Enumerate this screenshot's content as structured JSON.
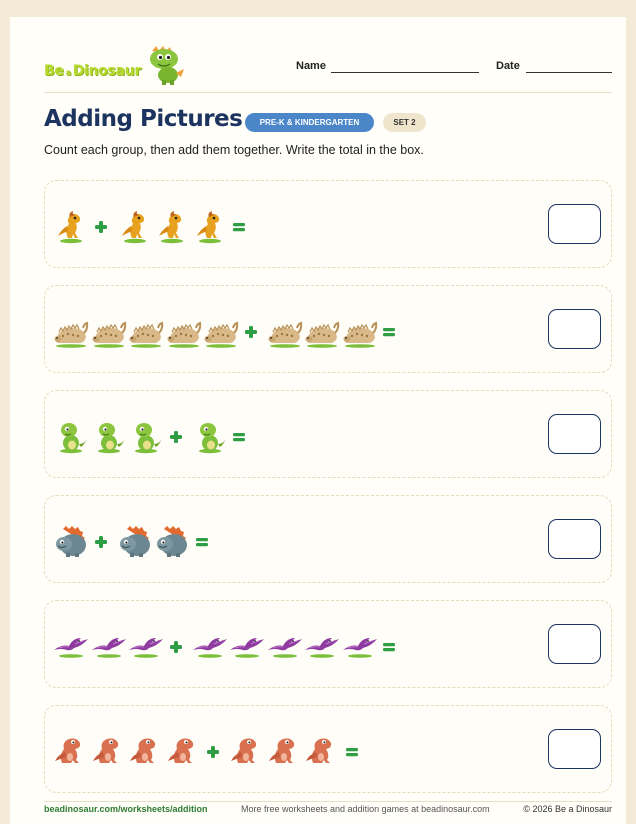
{
  "header": {
    "logo_word1": "Be",
    "logo_word2": "a",
    "logo_word3": "Dinosaur",
    "name_label": "Name",
    "date_label": "Date"
  },
  "title": "Adding Pictures",
  "badges": {
    "grade": "PRE-K & KINDERGARTEN",
    "set": "SET 2"
  },
  "instructions": "Count each group, then add them together. Write the total in the box.",
  "colors": {
    "title": "#1d3461",
    "grade_badge": "#4a86c8",
    "set_badge": "#efe5cc",
    "operator_green": "#2e9e44",
    "logo_green": "#b6d92d"
  },
  "problems": [
    {
      "dino": "orange-raptor-icon",
      "left_count": 1,
      "right_count": 3,
      "answer": ""
    },
    {
      "dino": "tan-ankylosaur-icon",
      "left_count": 5,
      "right_count": 3,
      "answer": ""
    },
    {
      "dino": "green-dino-icon",
      "left_count": 3,
      "right_count": 1,
      "answer": ""
    },
    {
      "dino": "gray-triceratops-icon",
      "left_count": 1,
      "right_count": 2,
      "answer": ""
    },
    {
      "dino": "purple-pterodactyl-icon",
      "left_count": 3,
      "right_count": 5,
      "answer": ""
    },
    {
      "dino": "red-raptor-icon",
      "left_count": 4,
      "right_count": 3,
      "answer": ""
    }
  ],
  "footer": {
    "left": "beadinosaur.com/worksheets/addition",
    "middle": "More free worksheets and addition games at beadinosaur.com",
    "right": "© 2026 Be a Dinosaur"
  }
}
